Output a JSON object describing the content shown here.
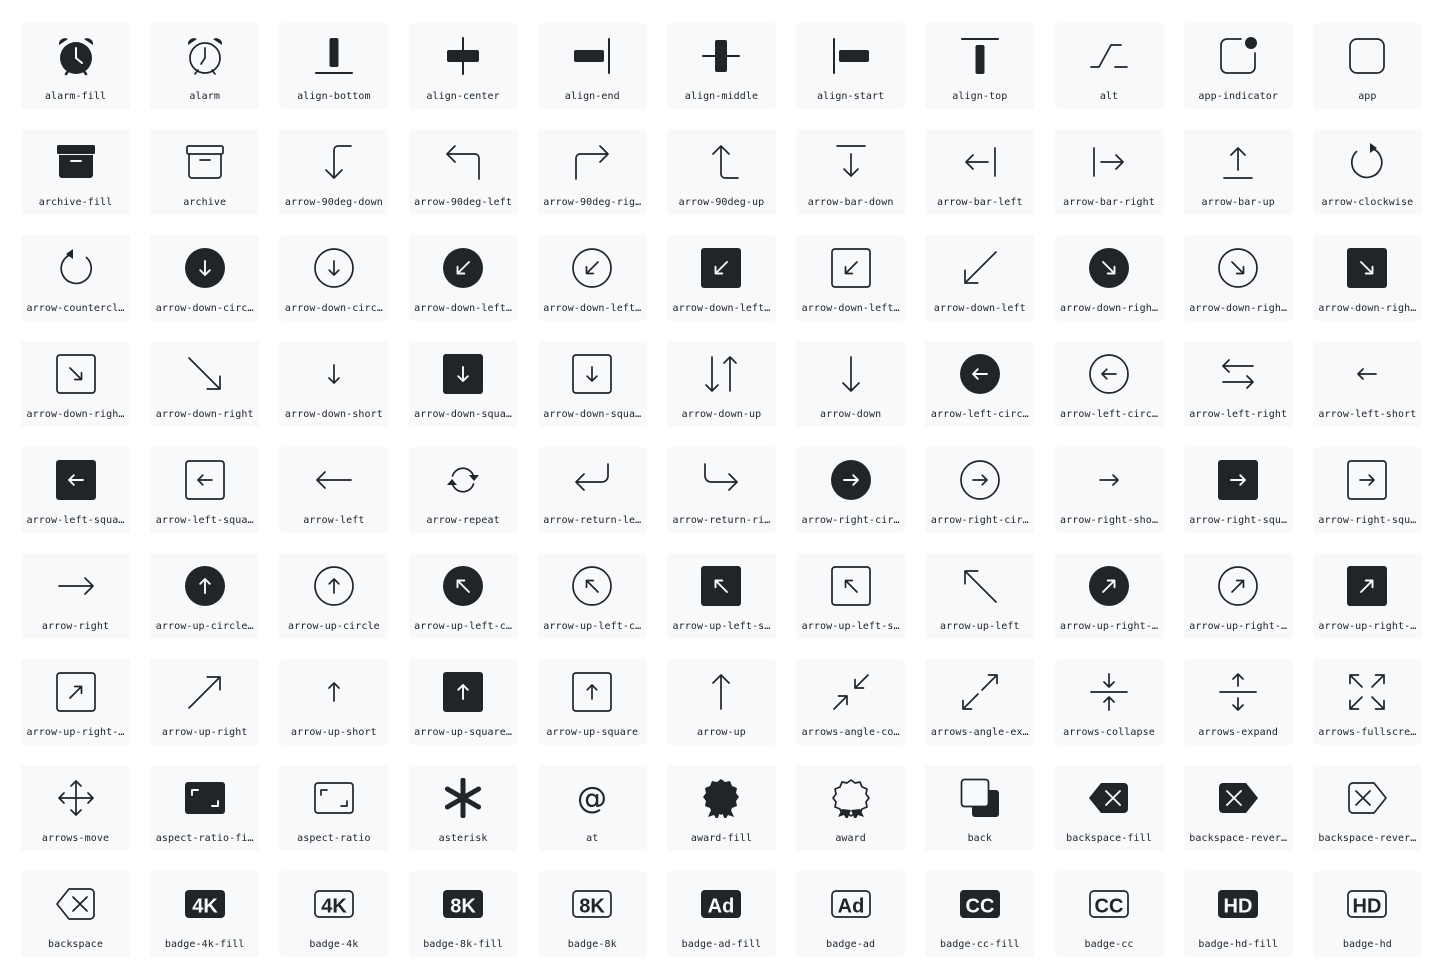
{
  "colors": {
    "icon": "#212529",
    "tile_bg": "#f8f9fa",
    "label": "#212529",
    "page_bg": "#ffffff"
  },
  "icons": [
    {
      "icon": "alarm-fill",
      "label": "alarm-fill"
    },
    {
      "icon": "alarm",
      "label": "alarm"
    },
    {
      "icon": "align-bottom",
      "label": "align-bottom"
    },
    {
      "icon": "align-center",
      "label": "align-center"
    },
    {
      "icon": "align-end",
      "label": "align-end"
    },
    {
      "icon": "align-middle",
      "label": "align-middle"
    },
    {
      "icon": "align-start",
      "label": "align-start"
    },
    {
      "icon": "align-top",
      "label": "align-top"
    },
    {
      "icon": "alt",
      "label": "alt"
    },
    {
      "icon": "app-indicator",
      "label": "app-indicator"
    },
    {
      "icon": "app",
      "label": "app"
    },
    {
      "icon": "archive-fill",
      "label": "archive-fill"
    },
    {
      "icon": "archive",
      "label": "archive"
    },
    {
      "icon": "arrow-90deg-down",
      "label": "arrow-90deg-down"
    },
    {
      "icon": "arrow-90deg-left",
      "label": "arrow-90deg-left"
    },
    {
      "icon": "arrow-90deg-right",
      "label": "arrow-90deg-rig…"
    },
    {
      "icon": "arrow-90deg-up",
      "label": "arrow-90deg-up"
    },
    {
      "icon": "arrow-bar-down",
      "label": "arrow-bar-down"
    },
    {
      "icon": "arrow-bar-left",
      "label": "arrow-bar-left"
    },
    {
      "icon": "arrow-bar-right",
      "label": "arrow-bar-right"
    },
    {
      "icon": "arrow-bar-up",
      "label": "arrow-bar-up"
    },
    {
      "icon": "arrow-clockwise",
      "label": "arrow-clockwise"
    },
    {
      "icon": "arrow-counterclockwise",
      "label": "arrow-countercl…"
    },
    {
      "icon": "arrow-down-circle-fill",
      "label": "arrow-down-circ…"
    },
    {
      "icon": "arrow-down-circle",
      "label": "arrow-down-circ…"
    },
    {
      "icon": "arrow-down-left-circle-fill",
      "label": "arrow-down-left…"
    },
    {
      "icon": "arrow-down-left-circle",
      "label": "arrow-down-left…"
    },
    {
      "icon": "arrow-down-left-square-fill",
      "label": "arrow-down-left…"
    },
    {
      "icon": "arrow-down-left-square",
      "label": "arrow-down-left…"
    },
    {
      "icon": "arrow-down-left",
      "label": "arrow-down-left"
    },
    {
      "icon": "arrow-down-right-circle-fill",
      "label": "arrow-down-righ…"
    },
    {
      "icon": "arrow-down-right-circle",
      "label": "arrow-down-righ…"
    },
    {
      "icon": "arrow-down-right-square-fill",
      "label": "arrow-down-righ…"
    },
    {
      "icon": "arrow-down-right-square",
      "label": "arrow-down-righ…"
    },
    {
      "icon": "arrow-down-right",
      "label": "arrow-down-right"
    },
    {
      "icon": "arrow-down-short",
      "label": "arrow-down-short"
    },
    {
      "icon": "arrow-down-square-fill",
      "label": "arrow-down-squa…"
    },
    {
      "icon": "arrow-down-square",
      "label": "arrow-down-squa…"
    },
    {
      "icon": "arrow-down-up",
      "label": "arrow-down-up"
    },
    {
      "icon": "arrow-down",
      "label": "arrow-down"
    },
    {
      "icon": "arrow-left-circle-fill",
      "label": "arrow-left-circ…"
    },
    {
      "icon": "arrow-left-circle",
      "label": "arrow-left-circ…"
    },
    {
      "icon": "arrow-left-right",
      "label": "arrow-left-right"
    },
    {
      "icon": "arrow-left-short",
      "label": "arrow-left-short"
    },
    {
      "icon": "arrow-left-square-fill",
      "label": "arrow-left-squa…"
    },
    {
      "icon": "arrow-left-square",
      "label": "arrow-left-squa…"
    },
    {
      "icon": "arrow-left",
      "label": "arrow-left"
    },
    {
      "icon": "arrow-repeat",
      "label": "arrow-repeat"
    },
    {
      "icon": "arrow-return-left",
      "label": "arrow-return-le…"
    },
    {
      "icon": "arrow-return-right",
      "label": "arrow-return-ri…"
    },
    {
      "icon": "arrow-right-circle-fill",
      "label": "arrow-right-cir…"
    },
    {
      "icon": "arrow-right-circle",
      "label": "arrow-right-cir…"
    },
    {
      "icon": "arrow-right-short",
      "label": "arrow-right-sho…"
    },
    {
      "icon": "arrow-right-square-fill",
      "label": "arrow-right-squ…"
    },
    {
      "icon": "arrow-right-square",
      "label": "arrow-right-squ…"
    },
    {
      "icon": "arrow-right",
      "label": "arrow-right"
    },
    {
      "icon": "arrow-up-circle-fill",
      "label": "arrow-up-circle…"
    },
    {
      "icon": "arrow-up-circle",
      "label": "arrow-up-circle"
    },
    {
      "icon": "arrow-up-left-circle-fill",
      "label": "arrow-up-left-c…"
    },
    {
      "icon": "arrow-up-left-circle",
      "label": "arrow-up-left-c…"
    },
    {
      "icon": "arrow-up-left-square-fill",
      "label": "arrow-up-left-s…"
    },
    {
      "icon": "arrow-up-left-square",
      "label": "arrow-up-left-s…"
    },
    {
      "icon": "arrow-up-left",
      "label": "arrow-up-left"
    },
    {
      "icon": "arrow-up-right-circle-fill",
      "label": "arrow-up-right-…"
    },
    {
      "icon": "arrow-up-right-circle",
      "label": "arrow-up-right-…"
    },
    {
      "icon": "arrow-up-right-square-fill",
      "label": "arrow-up-right-…"
    },
    {
      "icon": "arrow-up-right-square",
      "label": "arrow-up-right-…"
    },
    {
      "icon": "arrow-up-right",
      "label": "arrow-up-right"
    },
    {
      "icon": "arrow-up-short",
      "label": "arrow-up-short"
    },
    {
      "icon": "arrow-up-square-fill",
      "label": "arrow-up-square…"
    },
    {
      "icon": "arrow-up-square",
      "label": "arrow-up-square"
    },
    {
      "icon": "arrow-up",
      "label": "arrow-up"
    },
    {
      "icon": "arrows-angle-contract",
      "label": "arrows-angle-co…"
    },
    {
      "icon": "arrows-angle-expand",
      "label": "arrows-angle-ex…"
    },
    {
      "icon": "arrows-collapse",
      "label": "arrows-collapse"
    },
    {
      "icon": "arrows-expand",
      "label": "arrows-expand"
    },
    {
      "icon": "arrows-fullscreen",
      "label": "arrows-fullscre…"
    },
    {
      "icon": "arrows-move",
      "label": "arrows-move"
    },
    {
      "icon": "aspect-ratio-fill",
      "label": "aspect-ratio-fi…"
    },
    {
      "icon": "aspect-ratio",
      "label": "aspect-ratio"
    },
    {
      "icon": "asterisk",
      "label": "asterisk"
    },
    {
      "icon": "at",
      "label": "at"
    },
    {
      "icon": "award-fill",
      "label": "award-fill"
    },
    {
      "icon": "award",
      "label": "award"
    },
    {
      "icon": "back",
      "label": "back"
    },
    {
      "icon": "backspace-fill",
      "label": "backspace-fill"
    },
    {
      "icon": "backspace-reverse-fill",
      "label": "backspace-rever…"
    },
    {
      "icon": "backspace-reverse",
      "label": "backspace-rever…"
    },
    {
      "icon": "backspace",
      "label": "backspace"
    },
    {
      "icon": "badge-4k-fill",
      "label": "badge-4k-fill",
      "text": "4K"
    },
    {
      "icon": "badge-4k",
      "label": "badge-4k",
      "text": "4K"
    },
    {
      "icon": "badge-8k-fill",
      "label": "badge-8k-fill",
      "text": "8K"
    },
    {
      "icon": "badge-8k",
      "label": "badge-8k",
      "text": "8K"
    },
    {
      "icon": "badge-ad-fill",
      "label": "badge-ad-fill",
      "text": "Ad"
    },
    {
      "icon": "badge-ad",
      "label": "badge-ad",
      "text": "Ad"
    },
    {
      "icon": "badge-cc-fill",
      "label": "badge-cc-fill",
      "text": "CC"
    },
    {
      "icon": "badge-cc",
      "label": "badge-cc",
      "text": "CC"
    },
    {
      "icon": "badge-hd-fill",
      "label": "badge-hd-fill",
      "text": "HD"
    },
    {
      "icon": "badge-hd",
      "label": "badge-hd",
      "text": "HD"
    }
  ]
}
